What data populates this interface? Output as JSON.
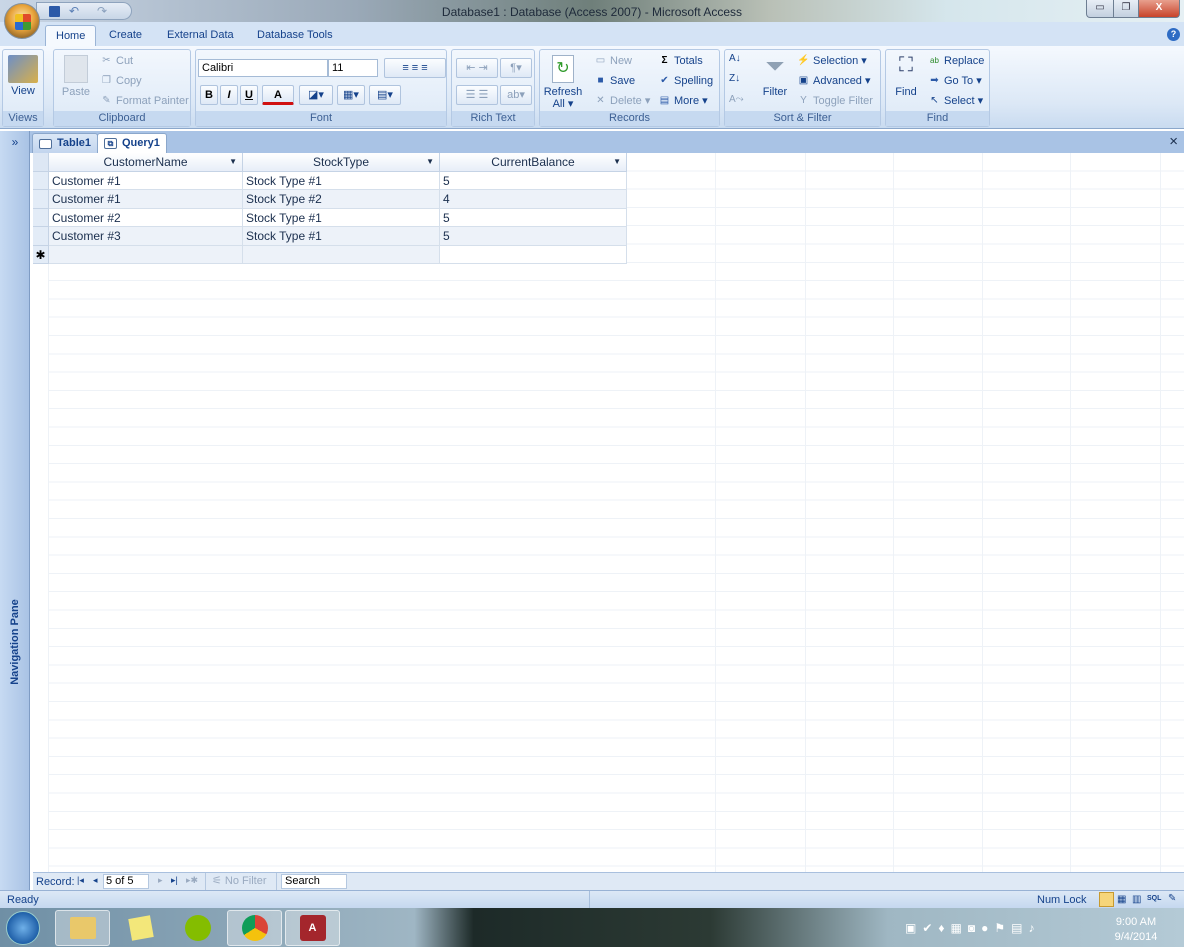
{
  "window": {
    "title": "Database1 : Database (Access 2007) - Microsoft Access",
    "minimize": "▭",
    "restore": "❐",
    "close": "X"
  },
  "ribbon_tabs": [
    "Home",
    "Create",
    "External Data",
    "Database Tools"
  ],
  "groups": {
    "views": {
      "label": "Views",
      "view": "View"
    },
    "clipboard": {
      "label": "Clipboard",
      "paste": "Paste",
      "cut": "Cut",
      "copy": "Copy",
      "format_painter": "Format Painter"
    },
    "font": {
      "label": "Font",
      "font_name": "Calibri",
      "font_size": "11",
      "bold": "B",
      "italic": "I",
      "underline": "U",
      "font_color": "A"
    },
    "rich_text": {
      "label": "Rich Text"
    },
    "records": {
      "label": "Records",
      "refresh": "Refresh",
      "refresh_all": "All ▾",
      "new": "New",
      "save": "Save",
      "delete": "Delete ▾",
      "totals": "Totals",
      "spelling": "Spelling",
      "more": "More ▾"
    },
    "sort_filter": {
      "label": "Sort & Filter",
      "filter": "Filter",
      "selection": "Selection ▾",
      "advanced": "Advanced ▾",
      "toggle_filter": "Toggle Filter"
    },
    "find": {
      "label": "Find",
      "find": "Find",
      "replace": "Replace",
      "goto": "Go To ▾",
      "select": "Select ▾"
    }
  },
  "nav_pane": {
    "label": "Navigation Pane",
    "toggle": "»"
  },
  "doc_tabs": [
    "Table1",
    "Query1"
  ],
  "doc_close": "×",
  "table": {
    "columns": [
      "CustomerName",
      "StockType",
      "CurrentBalance"
    ],
    "rows": [
      [
        "Customer #1",
        "Stock Type #1",
        "5"
      ],
      [
        "Customer #1",
        "Stock Type #2",
        "4"
      ],
      [
        "Customer #2",
        "Stock Type #1",
        "5"
      ],
      [
        "Customer #3",
        "Stock Type #1",
        "5"
      ]
    ],
    "new_row_marker": "✱"
  },
  "record_nav": {
    "label": "Record:",
    "first": "|◂",
    "prev": "◂",
    "current": "5 of 5",
    "next": "▸",
    "last": "▸|",
    "new": "▸✱",
    "no_filter": "No Filter",
    "search": "Search"
  },
  "status": {
    "left": "Ready",
    "num_lock": "Num Lock",
    "view_sql": "SQL"
  },
  "taskbar": {
    "time": "9:00 AM",
    "date": "9/4/2014"
  }
}
